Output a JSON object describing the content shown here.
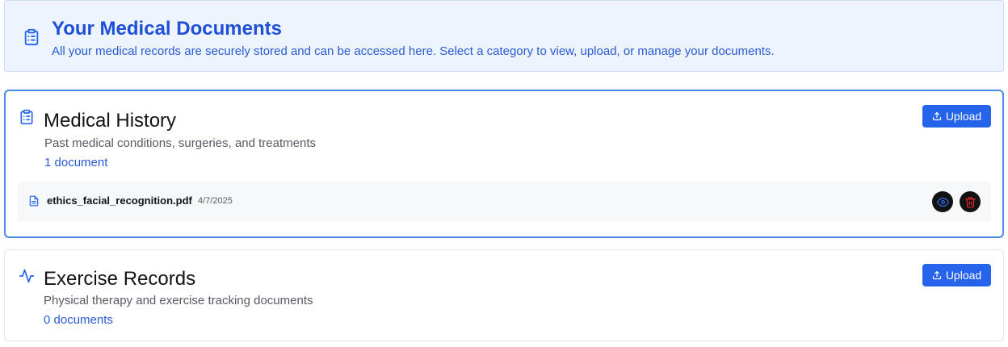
{
  "banner": {
    "icon": "clipboard-list-icon",
    "title": "Your Medical Documents",
    "subtitle": "All your medical records are securely stored and can be accessed here. Select a category to view, upload, or manage your documents."
  },
  "categories": [
    {
      "icon": "clipboard-list-icon",
      "title": "Medical History",
      "description": "Past medical conditions, surgeries, and treatments",
      "count": "1 document",
      "upload_label": "Upload",
      "documents": [
        {
          "icon": "file-text-icon",
          "name": "ethics_facial_recognition.pdf",
          "date": "4/7/2025",
          "view_icon": "eye-icon",
          "delete_icon": "trash-icon"
        }
      ]
    },
    {
      "icon": "activity-icon",
      "title": "Exercise Records",
      "description": "Physical therapy and exercise tracking documents",
      "count": "0 documents",
      "upload_label": "Upload",
      "documents": []
    }
  ],
  "colors": {
    "accent": "#2563eb",
    "banner_bg": "#eef4fd",
    "selected_border": "#4a8ae6",
    "delete": "#e02424"
  }
}
